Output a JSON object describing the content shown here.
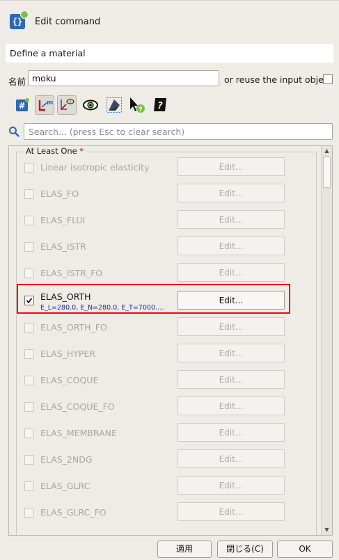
{
  "header": {
    "title": "Edit command",
    "icon": "command-braces-icon"
  },
  "section": {
    "title": "Define a material"
  },
  "name": {
    "label": "名前",
    "value": "moku",
    "reuse_label": "or reuse the input object",
    "reuse_checked": false
  },
  "toolbar": {
    "icons": [
      "hash-icon",
      "local-variable-icon",
      "visibility-toggle-icon",
      "eye-icon",
      "mesh-view-icon",
      "pointer-help-icon",
      "help-book-icon"
    ]
  },
  "search": {
    "placeholder": "Search... (press Esc to clear search)"
  },
  "group": {
    "title": "At Least One",
    "required_mark": "*"
  },
  "keywords": [
    {
      "label": "Linear isotropic elasticity",
      "checked": false,
      "button": "Edit..."
    },
    {
      "label": "ELAS_FO",
      "checked": false,
      "button": "Edit..."
    },
    {
      "label": "ELAS_FLUI",
      "checked": false,
      "button": "Edit..."
    },
    {
      "label": "ELAS_ISTR",
      "checked": false,
      "button": "Edit..."
    },
    {
      "label": "ELAS_ISTR_FO",
      "checked": false,
      "button": "Edit..."
    },
    {
      "label": "ELAS_ORTH",
      "checked": true,
      "summary": "E_L=280.0, E_N=280.0, E_T=7000.…",
      "button": "Edit..."
    },
    {
      "label": "ELAS_ORTH_FO",
      "checked": false,
      "button": "Edit..."
    },
    {
      "label": "ELAS_HYPER",
      "checked": false,
      "button": "Edit..."
    },
    {
      "label": "ELAS_COQUE",
      "checked": false,
      "button": "Edit..."
    },
    {
      "label": "ELAS_COQUE_FO",
      "checked": false,
      "button": "Edit..."
    },
    {
      "label": "ELAS_MEMBRANE",
      "checked": false,
      "button": "Edit..."
    },
    {
      "label": "ELAS_2NDG",
      "checked": false,
      "button": "Edit..."
    },
    {
      "label": "ELAS_GLRC",
      "checked": false,
      "button": "Edit..."
    },
    {
      "label": "ELAS_GLRC_FO",
      "checked": false,
      "button": "Edit..."
    }
  ],
  "footer": {
    "apply": "適用",
    "close": "閉じる(C)",
    "ok": "OK"
  },
  "colors": {
    "accent_blue": "#2c68b3",
    "highlight_red": "#e01010",
    "summary_blue": "#1a2ea8"
  }
}
